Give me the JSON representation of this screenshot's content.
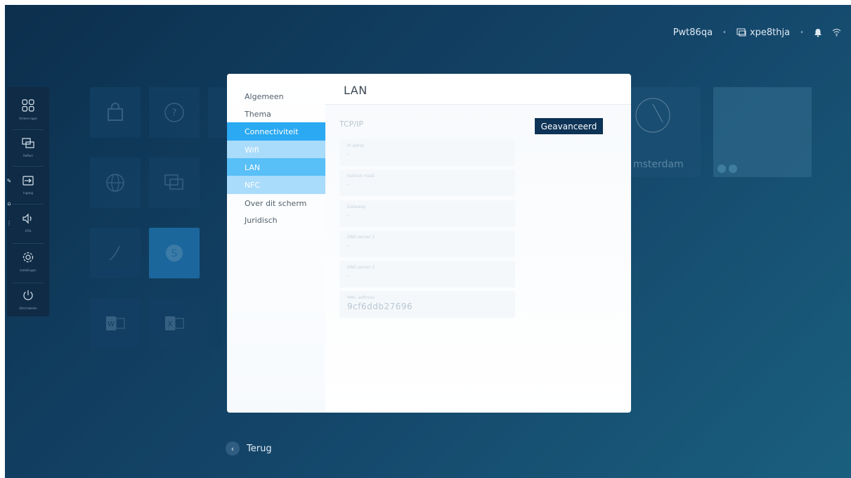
{
  "topbar": {
    "device_name": "Pwt86qa",
    "network_name": "xpe8thja",
    "icons": [
      "screen-share-icon",
      "bell-icon",
      "wifi-icon"
    ]
  },
  "sidebar": {
    "items": [
      {
        "label": "Actieve apps",
        "icon": "apps-grid-icon"
      },
      {
        "label": "Reflect",
        "icon": "reflect-icon"
      },
      {
        "label": "Ingang",
        "icon": "input-icon"
      },
      {
        "label": "25%",
        "icon": "volume-icon"
      },
      {
        "label": "Instellingen",
        "icon": "gear-icon"
      },
      {
        "label": "Uitschakelen",
        "icon": "power-icon"
      }
    ]
  },
  "background": {
    "weather_city": "msterdam"
  },
  "settings": {
    "nav": [
      {
        "label": "Algemeen"
      },
      {
        "label": "Thema"
      },
      {
        "label": "Connectiviteit"
      },
      {
        "label": "Wifi"
      },
      {
        "label": "LAN"
      },
      {
        "label": "NFC"
      },
      {
        "label": "Over dit scherm"
      },
      {
        "label": "Juridisch"
      }
    ],
    "content": {
      "title": "LAN",
      "section": "TCP/IP",
      "advanced_button": "Geavanceerd",
      "fields": [
        {
          "label": "IP-adres",
          "value": "-"
        },
        {
          "label": "Subnet mask",
          "value": "-"
        },
        {
          "label": "Gateway",
          "value": "-"
        },
        {
          "label": "DNS server 1",
          "value": "-"
        },
        {
          "label": "DNS server 2",
          "value": "-"
        },
        {
          "label": "MAC-address",
          "value": "9cf6ddb27696"
        }
      ]
    }
  },
  "back": {
    "label": "Terug"
  },
  "colors": {
    "active_nav": "#2ba9f2",
    "sub_nav": "#a9dbfb",
    "button": "#0d3356",
    "sidebar": "#0f2b45"
  }
}
